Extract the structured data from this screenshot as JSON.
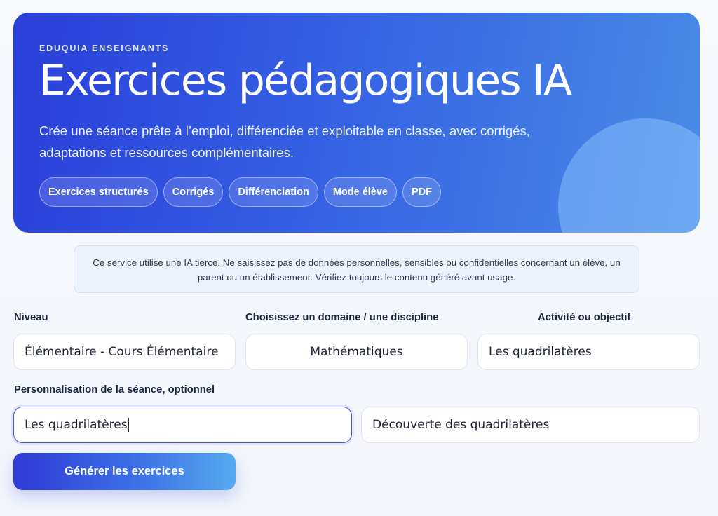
{
  "hero": {
    "eyebrow": "EDUQUIA ENSEIGNANTS",
    "title": "Exercices pédagogiques IA",
    "subtitle": "Crée une séance prête à l’emploi, différenciée et exploitable en classe, avec corrigés, adaptations et ressources complémentaires.",
    "chips": [
      "Exercices structurés",
      "Corrigés",
      "Différenciation",
      "Mode élève",
      "PDF"
    ]
  },
  "notice": {
    "text": "Ce service utilise une IA tierce. Ne saisissez pas de données personnelles, sensibles ou confidentielles concernant un élève, un parent ou un établissement. Vérifiez toujours le contenu généré avant usage."
  },
  "form": {
    "niveau_label": "Niveau",
    "niveau_value": "Élémentaire - Cours Élémentaire",
    "domaine_label": "Choisissez un domaine / une discipline",
    "domaine_value": "Mathématiques",
    "activite_label": "Activité ou objectif",
    "activite_value": "Les quadrilatères",
    "perso_label": "Personnalisation de la séance, optionnel",
    "perso_value": "Les quadrilatères",
    "perso_detail_value": "Découverte des quadrilatères",
    "generate_label": "Générer les exercices"
  },
  "colors": {
    "hero_start": "#2a3fd9",
    "hero_end": "#4a8ce6",
    "focus_border": "#4f57d8",
    "notice_bg": "#edf3fd"
  }
}
